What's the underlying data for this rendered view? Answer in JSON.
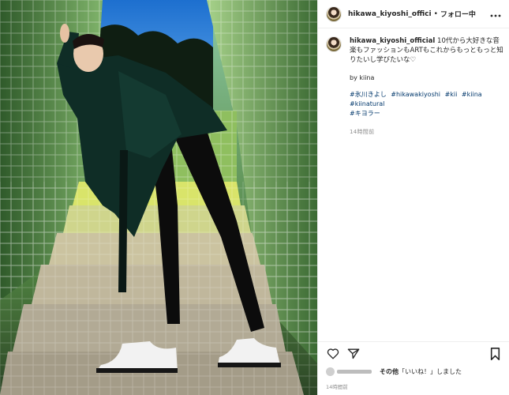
{
  "post": {
    "username_short": "hikawa_kiyoshi_offici",
    "separator": "•",
    "follow_label": "フォロー中",
    "more_icon": "more-horizontal-icon",
    "caption_user": "hikawa_kiyoshi_official",
    "caption_text": "10代から大好きな音楽もファッションもARTもこれからもっともっと知りたいし学びたいな♡",
    "by_line": "by kiina",
    "hashtags": [
      "#氷川きよし",
      "#hikawakiyoshi",
      "#kii",
      "#kiina",
      "#kiinatural",
      "#キヨラー"
    ],
    "posted_ago": "14時間前",
    "likes_text_before": "その他",
    "likes_text_quote": "「いいね！」",
    "likes_text_after": "しました",
    "date": "14時間前"
  },
  "icons": {
    "heart": "heart-icon",
    "share": "share-icon",
    "bookmark": "bookmark-icon"
  },
  "colors": {
    "text": "#262626",
    "hashtag": "#00376b",
    "muted": "#8e8e8e",
    "border": "#efefef"
  }
}
